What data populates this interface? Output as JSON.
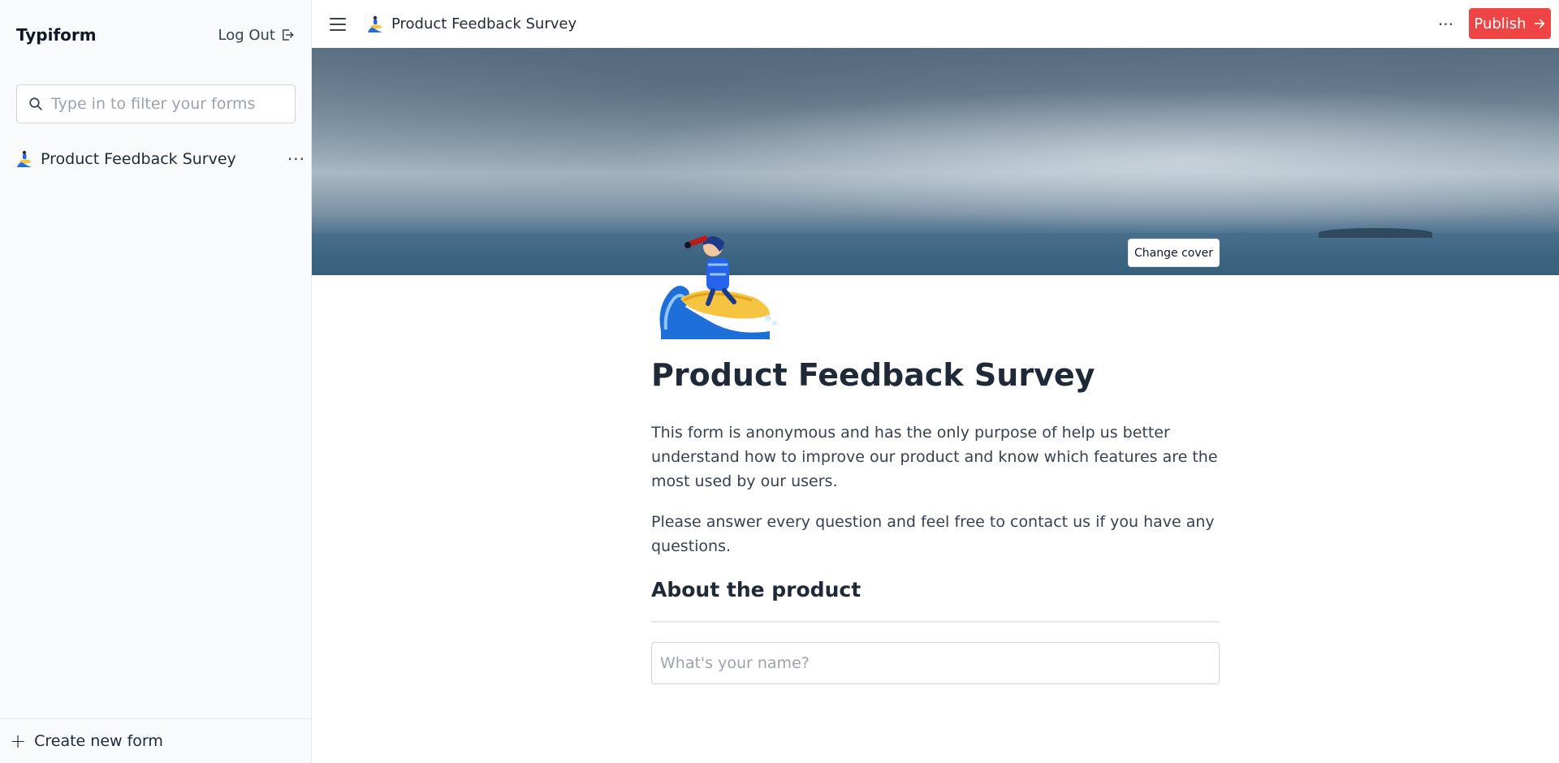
{
  "sidebar": {
    "brand": "Typiform",
    "logout_label": "Log Out",
    "search": {
      "placeholder": "Type in to filter your forms"
    },
    "forms": [
      {
        "label": "Product Feedback Survey"
      }
    ],
    "create_label": "Create new form"
  },
  "topbar": {
    "title": "Product Feedback Survey",
    "more_label": "···",
    "publish_label": "Publish"
  },
  "cover": {
    "change_label": "Change cover"
  },
  "form": {
    "title": "Product Feedback Survey",
    "description": "This form is anonymous and has the only purpose of help us better understand how to improve our product and know which features are the most used by our users.",
    "instructions": "Please answer every question and feel free to contact us if you have any questions.",
    "section_heading": "About the product",
    "name_field": {
      "placeholder": "What's your name?"
    }
  },
  "colors": {
    "accent": "#ef4444",
    "sidebar_bg": "#f8fafc"
  },
  "icons": [
    "search-icon",
    "logout-icon",
    "hamburger-icon",
    "more-icon",
    "arrow-right-icon",
    "plus-icon",
    "surfer-emoji-icon"
  ]
}
